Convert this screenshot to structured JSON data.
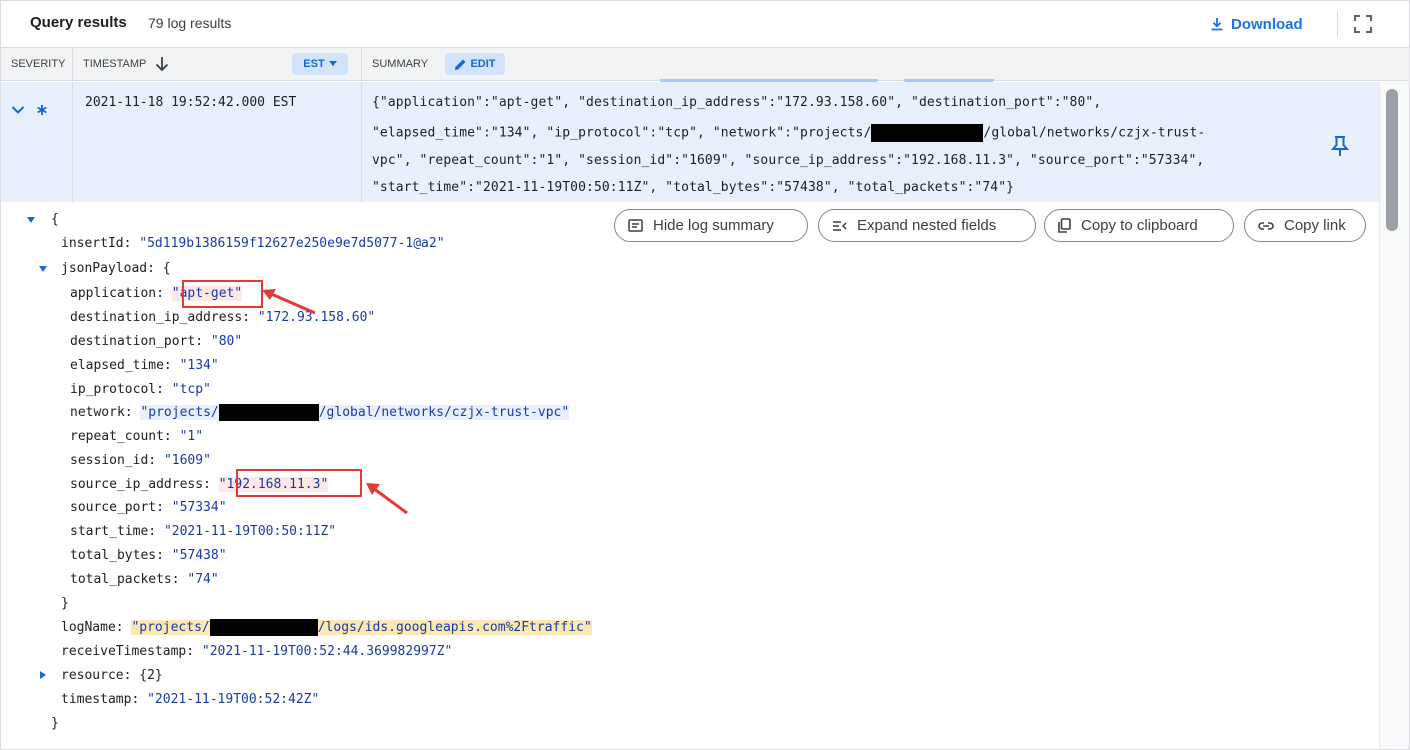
{
  "header": {
    "title": "Query results",
    "count": "79 log results",
    "download_label": "Download"
  },
  "columns": {
    "severity": "SEVERITY",
    "timestamp": "TIMESTAMP",
    "timezone": "EST",
    "summary": "SUMMARY",
    "edit": "EDIT"
  },
  "row": {
    "timestamp": "2021-11-18 19:52:42.000 EST",
    "summary_lines": [
      {
        "pre": "{\"application\":\"apt-get\", \"destination_ip_address\":\"172.93.158.60\", \"destination_port\":\"80\",",
        "post": ""
      },
      {
        "pre": "\"elapsed_time\":\"134\", \"ip_protocol\":\"tcp\", \"network\":\"projects/",
        "post": "/global/networks/czjx-trust-"
      },
      {
        "pre": "vpc\", \"repeat_count\":\"1\", \"session_id\":\"1609\", \"source_ip_address\":\"192.168.11.3\", \"source_port\":\"57334\",",
        "post": ""
      },
      {
        "pre": "\"start_time\":\"2021-11-19T00:50:11Z\", \"total_bytes\":\"57438\", \"total_packets\":\"74\"}",
        "post": ""
      }
    ]
  },
  "actions": {
    "hide_summary": "Hide log summary",
    "expand_nested": "Expand nested fields",
    "copy_clipboard": "Copy to clipboard",
    "copy_link": "Copy link"
  },
  "json": {
    "open_brace": "{",
    "insertId_key": "insertId",
    "insertId_val": "\"5d119b1386159f12627e250e9e7d5077-1@a2\"",
    "jsonPayload_key": "jsonPayload",
    "jsonPayload_open": "{",
    "fields": [
      {
        "key": "application",
        "val": "\"apt-get\""
      },
      {
        "key": "destination_ip_address",
        "val": "\"172.93.158.60\""
      },
      {
        "key": "destination_port",
        "val": "\"80\""
      },
      {
        "key": "elapsed_time",
        "val": "\"134\""
      },
      {
        "key": "ip_protocol",
        "val": "\"tcp\""
      },
      {
        "key": "network",
        "val_pre": "\"projects/",
        "val_post": "/global/networks/czjx-trust-vpc\""
      },
      {
        "key": "repeat_count",
        "val": "\"1\""
      },
      {
        "key": "session_id",
        "val": "\"1609\""
      },
      {
        "key": "source_ip_address",
        "val": "\"192.168.11.3\""
      },
      {
        "key": "source_port",
        "val": "\"57334\""
      },
      {
        "key": "start_time",
        "val": "\"2021-11-19T00:50:11Z\""
      },
      {
        "key": "total_bytes",
        "val": "\"57438\""
      },
      {
        "key": "total_packets",
        "val": "\"74\""
      }
    ],
    "jsonPayload_close": "}",
    "logName_key": "logName",
    "logName_pre": "\"projects/",
    "logName_post": "/logs/ids.googleapis.com%2Ftraffic\"",
    "receiveTimestamp_key": "receiveTimestamp",
    "receiveTimestamp_val": "\"2021-11-19T00:52:44.369982997Z\"",
    "resource_key": "resource",
    "resource_val": "{2}",
    "timestamp_key": "timestamp",
    "timestamp_val": "\"2021-11-19T00:52:42Z\"",
    "close_brace": "}"
  },
  "colors": {
    "accent": "#1a73e8",
    "string": "#1a3aa6",
    "annotation_red": "#e53935",
    "highlight_yellow": "#fce8b2"
  }
}
